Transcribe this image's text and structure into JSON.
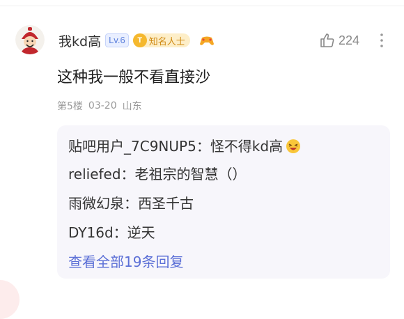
{
  "comment": {
    "username": "我kd高",
    "level": "Lv.6",
    "title_badge_symbol": "T",
    "title_badge": "知名人士",
    "like_count": "224",
    "body": "这种我一般不看直接沙",
    "floor": "第5楼",
    "date": "03-20",
    "location": "山东",
    "icons": {
      "avatar": "avatar-cartoon-red-hat",
      "game": "gamepad-icon",
      "like": "thumbs-up-icon",
      "more": "more-vertical-icon"
    }
  },
  "replies": [
    {
      "nick": "贴吧用户_7C9NUP5",
      "separator": "：",
      "text": "怪不得kd高",
      "emoji": "laughing-emoji"
    },
    {
      "nick": "reliefed",
      "separator": "：",
      "text": "老祖宗的智慧（）"
    },
    {
      "nick": "雨微幻泉",
      "separator": "：",
      "text": "西圣千古"
    },
    {
      "nick": "DY16d",
      "separator": "：",
      "text": "逆天"
    }
  ],
  "view_more": "查看全部19条回复",
  "colors": {
    "accent": "#5b6fd6",
    "level_badge": "#5b7fdc",
    "title_badge_bg": "#fdeec8",
    "reply_bg": "#f7f6fb"
  }
}
